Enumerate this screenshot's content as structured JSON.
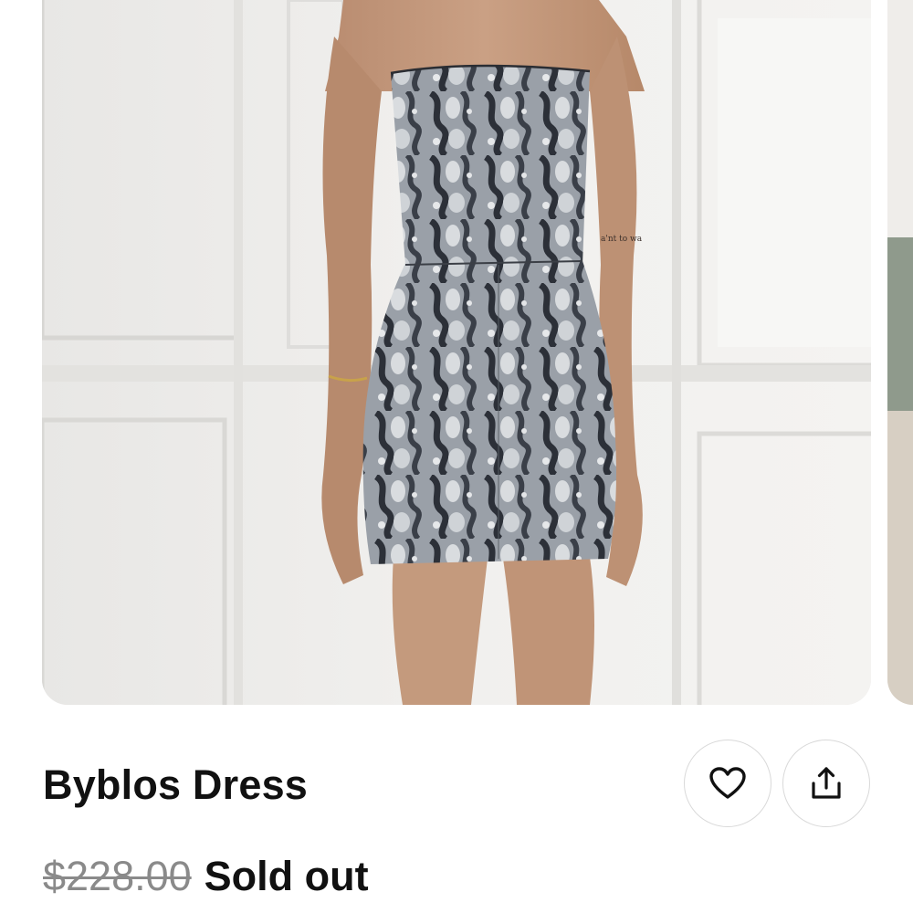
{
  "product": {
    "name": "Byblos Dress",
    "original_price": "$228.00",
    "status": "Sold out"
  },
  "actions": {
    "like_icon": "heart-icon",
    "share_icon": "share-icon"
  },
  "colors": {
    "text": "#111111",
    "strikethrough_price": "#8a8a8a",
    "button_border": "#d9d9d9"
  }
}
